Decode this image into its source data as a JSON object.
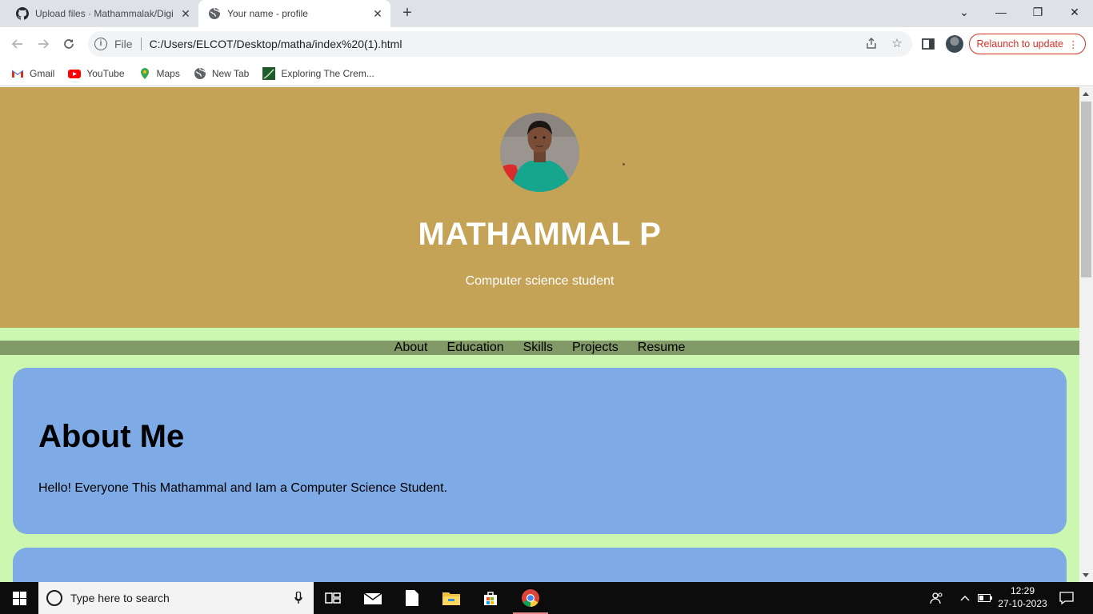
{
  "browser": {
    "tabs": [
      {
        "title": "Upload files · Mathammalak/Digi",
        "icon": "github-icon",
        "active": false
      },
      {
        "title": "Your name - profile",
        "icon": "globe-icon",
        "active": true
      }
    ],
    "address": {
      "scheme": "File",
      "url": "C:/Users/ELCOT/Desktop/matha/index%20(1).html"
    },
    "relaunch_label": "Relaunch to update",
    "bookmarks": [
      {
        "label": "Gmail",
        "icon": "gmail-icon"
      },
      {
        "label": "YouTube",
        "icon": "youtube-icon"
      },
      {
        "label": "Maps",
        "icon": "maps-icon"
      },
      {
        "label": "New Tab",
        "icon": "globe-icon"
      },
      {
        "label": "Exploring The Crem...",
        "icon": "site-icon"
      }
    ]
  },
  "page": {
    "hero": {
      "name": "MATHAMMAL P",
      "subtitle": "Computer science student"
    },
    "nav": [
      "About",
      "Education",
      "Skills",
      "Projects",
      "Resume"
    ],
    "about": {
      "heading": "About Me",
      "text": "Hello! Everyone This Mathammal and Iam a Computer Science Student."
    }
  },
  "colors": {
    "hero_bg": "#c4a256",
    "page_bg": "#ccf7b0",
    "nav_bg": "#819a68",
    "card_bg": "#7eaae6",
    "relaunch": "#d93025"
  },
  "taskbar": {
    "search_placeholder": "Type here to search",
    "time": "12:29",
    "date": "27-10-2023"
  }
}
